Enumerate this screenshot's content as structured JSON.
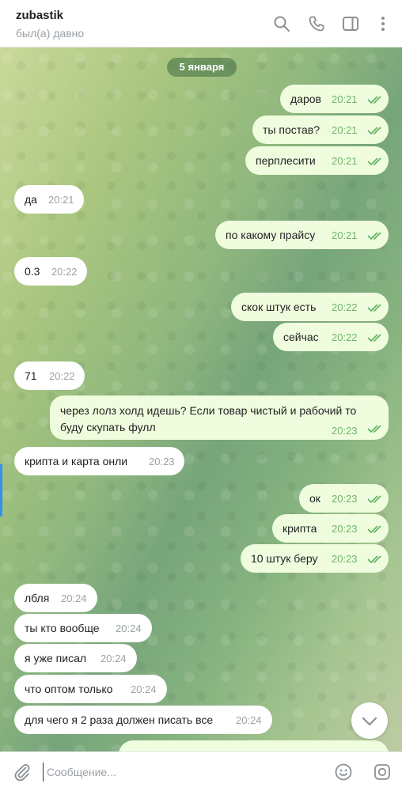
{
  "header": {
    "title": "zubastik",
    "status": "был(а) давно",
    "icons": [
      "search-icon",
      "call-icon",
      "sidebar-toggle-icon",
      "more-icon"
    ]
  },
  "chat": {
    "date_badge": "5 января",
    "messages": [
      {
        "dir": "out",
        "text": "даров",
        "time": "20:21",
        "read": true
      },
      {
        "dir": "out",
        "text": "ты постав?",
        "time": "20:21",
        "read": true
      },
      {
        "dir": "out",
        "text": "перплесити",
        "time": "20:21",
        "read": true
      },
      {
        "dir": "in",
        "text": "да",
        "time": "20:21"
      },
      {
        "dir": "out",
        "text": "по какому прайсу",
        "time": "20:21",
        "read": true
      },
      {
        "dir": "in",
        "text": "0.3",
        "time": "20:22"
      },
      {
        "dir": "out",
        "text": "скок штук есть",
        "time": "20:22",
        "read": true
      },
      {
        "dir": "out",
        "text": "сейчас",
        "time": "20:22",
        "read": true
      },
      {
        "dir": "in",
        "text": "71",
        "time": "20:22"
      },
      {
        "dir": "out",
        "text": "через лолз холд идешь? Если товар чистый и рабочий то буду скупать фулл",
        "time": "20:23",
        "read": true
      },
      {
        "dir": "in",
        "text": "крипта и карта онли",
        "time": "20:23"
      },
      {
        "dir": "out",
        "text": "ок",
        "time": "20:23",
        "read": true
      },
      {
        "dir": "out",
        "text": "крипта",
        "time": "20:23",
        "read": true
      },
      {
        "dir": "out",
        "text": "10 штук беру",
        "time": "20:23",
        "read": true
      },
      {
        "dir": "in",
        "text": "лбля",
        "time": "20:24"
      },
      {
        "dir": "in",
        "text": "ты кто вообще",
        "time": "20:24"
      },
      {
        "dir": "in",
        "text": "я уже писал",
        "time": "20:24"
      },
      {
        "dir": "in",
        "text": "что оптом только",
        "time": "20:24"
      },
      {
        "dir": "in",
        "text": "для чего я 2 раза должен писать все",
        "time": "20:24"
      }
    ]
  },
  "composer": {
    "placeholder": "Сообщение...",
    "icons": [
      "attach-icon",
      "emoji-icon",
      "camera-icon"
    ]
  },
  "colors": {
    "outgoing_bubble": "#effdde",
    "incoming_bubble": "#ffffff",
    "read_check": "#5fb15f",
    "accent": "#3390ec"
  }
}
